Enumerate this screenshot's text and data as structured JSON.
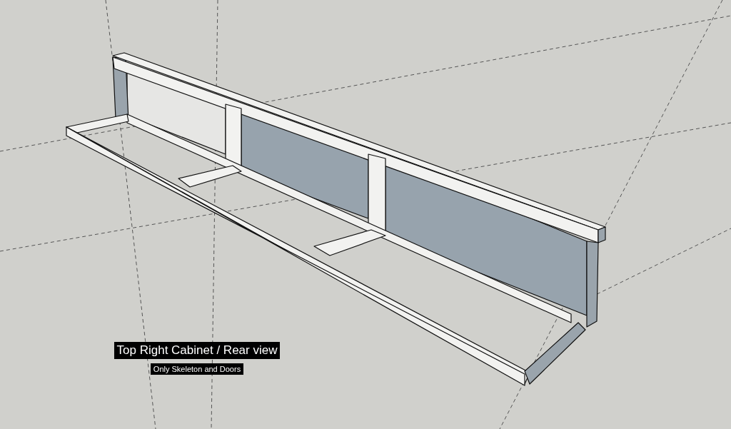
{
  "viewport": {
    "labels": [
      {
        "kind": "title",
        "text": "Top Right Cabinet / Rear view"
      },
      {
        "kind": "subtitle",
        "text": "Only Skeleton and Doors"
      }
    ]
  }
}
